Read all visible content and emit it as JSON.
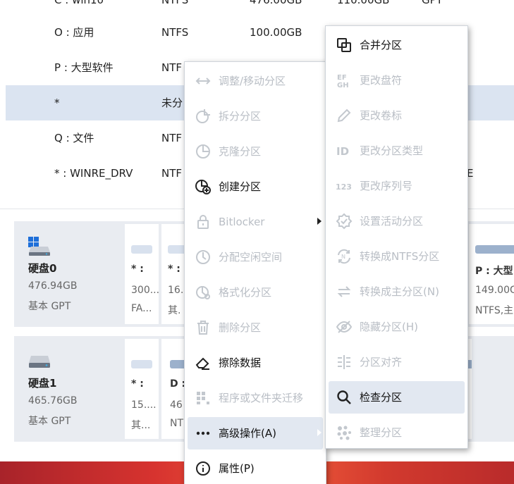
{
  "partitions": [
    {
      "name": "C : win10",
      "fs": "NTFS",
      "size": "476.00GB",
      "used": "110.00GB",
      "type": "GPT"
    },
    {
      "name": "O : 应用",
      "fs": "NTFS",
      "size": "100.00GB"
    },
    {
      "name": "P : 大型软件",
      "fs": "NTF"
    },
    {
      "name": "*",
      "fs": "未分"
    },
    {
      "name": "Q : 文件",
      "fs": "NTF"
    },
    {
      "name": "* : WINRE_DRV",
      "fs": "NTF",
      "type": "E"
    }
  ],
  "disks": [
    {
      "title": "硬盘0",
      "size": "476.94GB",
      "style": "基本 GPT",
      "parts": [
        {
          "label": "* :",
          "size": "300...",
          "fs": "FA..."
        },
        {
          "label": "* :",
          "size": "16.",
          "fs": "其."
        },
        {
          "label": "P : 大型",
          "size": "149.00G",
          "fs": "NTFS,主"
        }
      ]
    },
    {
      "title": "硬盘1",
      "size": "465.76GB",
      "style": "基本 GPT",
      "parts": [
        {
          "label": "* :",
          "size": "15....",
          "fs": "其..."
        },
        {
          "label": "D :",
          "size": "46",
          "fs": "NT"
        }
      ]
    }
  ],
  "menu": {
    "items": [
      {
        "icon": "resize-move-icon",
        "label": "调整/移动分区",
        "enabled": false
      },
      {
        "icon": "split-icon",
        "label": "拆分分区",
        "enabled": false
      },
      {
        "icon": "clone-icon",
        "label": "克隆分区",
        "enabled": false
      },
      {
        "icon": "create-partition-icon",
        "label": "创建分区",
        "enabled": true
      },
      {
        "icon": "lock-icon",
        "label": "Bitlocker",
        "enabled": false,
        "submenu": true
      },
      {
        "icon": "allocate-icon",
        "label": "分配空闲空间",
        "enabled": false
      },
      {
        "icon": "format-icon",
        "label": "格式化分区",
        "enabled": false
      },
      {
        "icon": "trash-icon",
        "label": "删除分区",
        "enabled": false
      },
      {
        "icon": "eraser-icon",
        "label": "擦除数据",
        "enabled": true
      },
      {
        "icon": "migrate-icon",
        "label": "程序或文件夹迁移",
        "enabled": false
      },
      {
        "icon": "more-icon",
        "label": "高级操作(A)",
        "enabled": true,
        "submenu": true,
        "highlighted": true
      },
      {
        "icon": "info-icon",
        "label": "属性(P)",
        "enabled": true
      }
    ]
  },
  "submenu": {
    "items": [
      {
        "icon": "merge-icon",
        "label": "合并分区",
        "enabled": true
      },
      {
        "icon": "drive-letter-icon",
        "label": "更改盘符",
        "enabled": false
      },
      {
        "icon": "pencil-icon",
        "label": "更改卷标",
        "enabled": false
      },
      {
        "icon": "id-icon",
        "label": "更改分区类型",
        "enabled": false
      },
      {
        "icon": "serial-icon",
        "label": "更改序列号",
        "enabled": false
      },
      {
        "icon": "active-icon",
        "label": "设置活动分区",
        "enabled": false
      },
      {
        "icon": "ntfs-icon",
        "label": "转换成NTFS分区",
        "enabled": false
      },
      {
        "icon": "convert-icon",
        "label": "转换成主分区(N)",
        "enabled": false
      },
      {
        "icon": "hide-icon",
        "label": "隐藏分区(H)",
        "enabled": false
      },
      {
        "icon": "align-icon",
        "label": "分区对齐",
        "enabled": false
      },
      {
        "icon": "search-icon",
        "label": "检查分区",
        "enabled": true,
        "highlighted": true
      },
      {
        "icon": "defrag-icon",
        "label": "整理分区",
        "enabled": false
      }
    ]
  }
}
